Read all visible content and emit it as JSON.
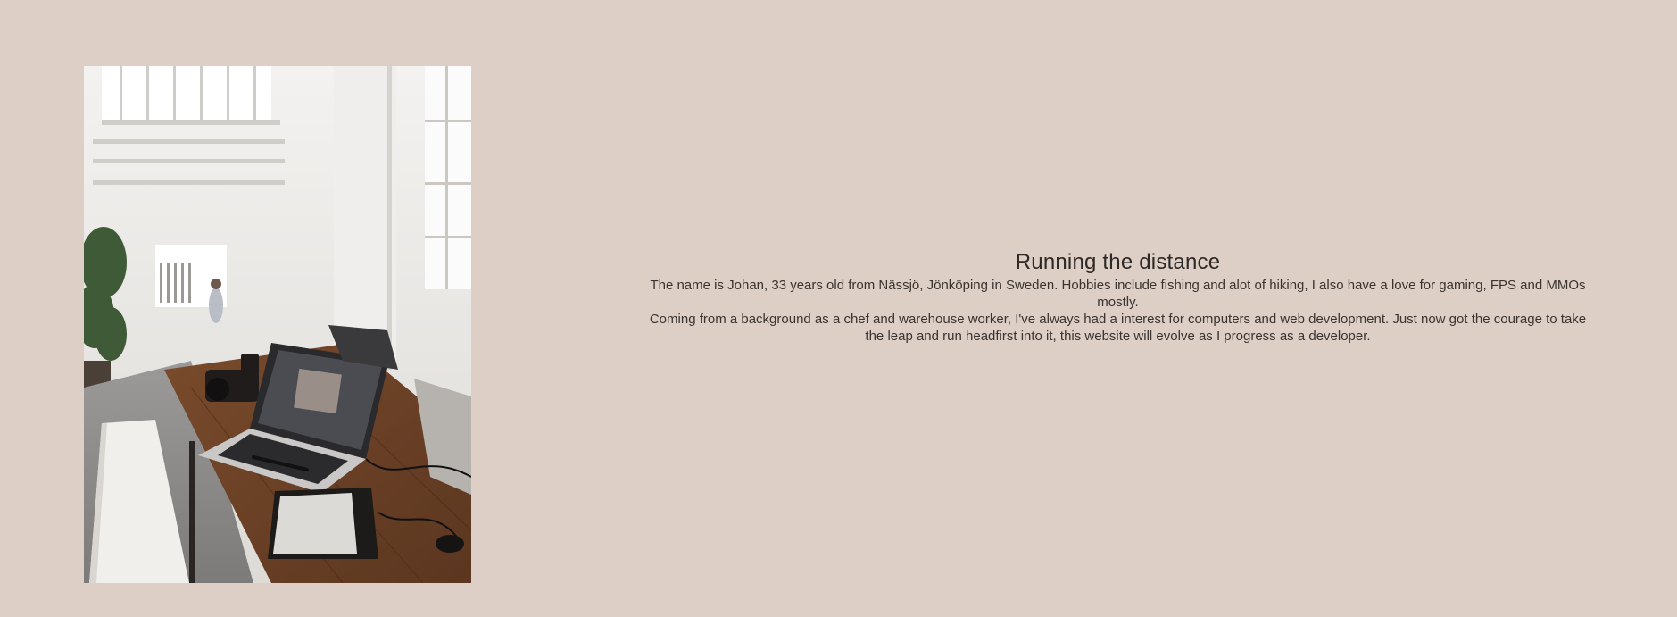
{
  "colors": {
    "background": "#ddcfc6",
    "text": "#3a3330"
  },
  "hero_image": {
    "icon": "workspace-photo",
    "subject": "laptop and camera on a wooden table in a bright studio"
  },
  "about": {
    "title": "Running the distance",
    "paragraph_1": "The name is Johan, 33 years old from Nässjö, Jönköping in Sweden. Hobbies include fishing and alot of hiking, I also have a love for gaming, FPS and MMOs mostly.",
    "paragraph_2": "Coming from a background as a chef and warehouse worker, I've always had a interest for computers and web development. Just now got the courage to take the leap and run headfirst into it, this website will evolve as I progress as a developer."
  }
}
